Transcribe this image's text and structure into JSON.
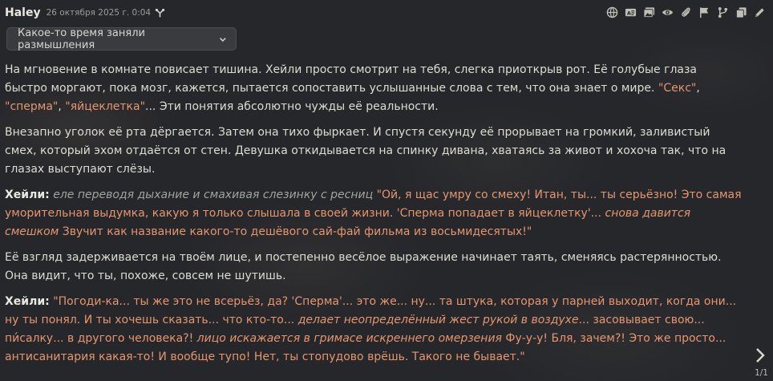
{
  "message": {
    "author": "Haley",
    "timestamp": "26 октября 2025 г. 0:04",
    "reasoning_label": "Какое-то время заняли размышления",
    "swipe_counter": "1/1"
  },
  "paragraphs": {
    "p1": {
      "s1": "На мгновение в комнате повисает тишина. Хейли просто смотрит на тебя, слегка приоткрыв рот. Её голубые глаза быстро моргают, пока мозг, кажется, пытается сопоставить услышанные слова с тем, что она знает о мире. ",
      "q1": "\"Секс\"",
      "s2": ", ",
      "q2": "\"сперма\"",
      "s3": ", ",
      "q3": "\"яйцеклетка\"",
      "s4": "... Эти понятия абсолютно чужды её реальности."
    },
    "p2": "Внезапно уголок её рта дёргается. Затем она тихо фыркает. И спустя секунду её прорывает на громкий, заливистый смех, который эхом отдаётся от стен. Девушка откидывается на спинку дивана, хватаясь за живот и хохоча так, что на глазах выступают слёзы.",
    "p3": {
      "speaker": "Хейли:",
      "action": "еле переводя дыхание и смахивая слезинку с ресниц",
      "q1": "\"Ой, я щас умру со смеху! Итан, ты... ты серьёзно! Это самая уморительная выдумка, какую я только слышала в своей жизни. 'Сперма попадает в яйцеклетку'...",
      "qi1": "снова давится смешком",
      "q2": "Звучит как название какого-то дешёвого сай-фай фильма из восьмидесятых!\""
    },
    "p4": "Её взгляд задерживается на твоём лице, и постепенно весёлое выражение начинает таять, сменяясь растерянностью. Она видит, что ты, похоже, совсем не шутишь.",
    "p5": {
      "speaker": "Хейли:",
      "q1": "\"Погоди-ка... ты же это не всерьёз, да? 'Сперма'... это же... ну... та штука, которая у парней выходит, когда они... ну ты понял. И ты хочешь сказать... что кто-то...",
      "qi1": "делает неопределённый жест рукой в воздухе",
      "q2": "... засовывает свою... пи́салку... в другого человека?!",
      "qi2": "лицо искажается в гримасе искреннего омерзения",
      "q3": "Фу-у-у! Бля, зачем?! Это же просто... антисанитария какая-то! И вообще тупо! Нет, ты стопудово врёшь. Такого не бывает.\""
    }
  },
  "icons": {
    "branch": "branch-icon",
    "actions": [
      "globe-icon",
      "text-ab-icon",
      "images-icon",
      "eye-icon",
      "paperclip-icon",
      "flag-icon",
      "fork-icon",
      "copy-icon",
      "pencil-icon"
    ],
    "swipe": "chevron-right-icon",
    "reasoning": "chevron-down-icon"
  }
}
